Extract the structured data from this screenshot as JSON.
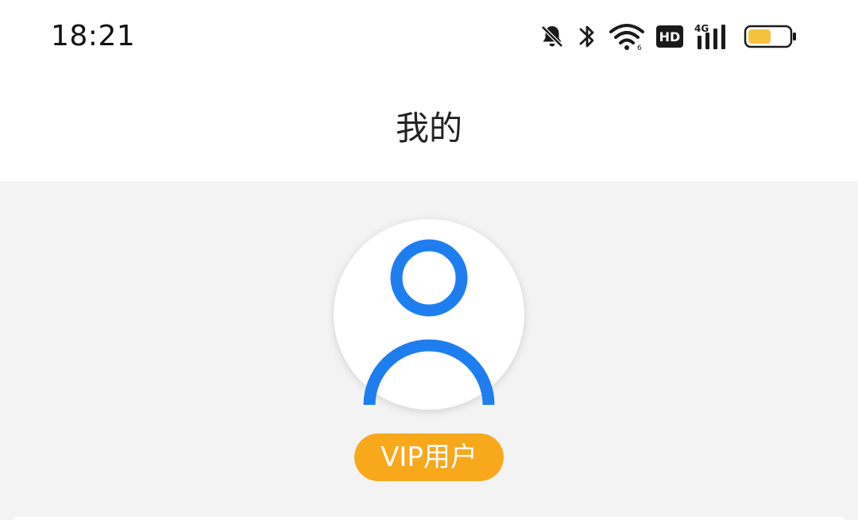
{
  "status_bar": {
    "time": "18:21",
    "icons": [
      "bell-off-icon",
      "bluetooth-icon",
      "wifi-icon",
      "hd-icon",
      "signal-4g-icon",
      "battery-icon"
    ],
    "hd_label": "HD",
    "network_label": "4G",
    "battery_level": 0.55,
    "battery_color": "#f5c23e"
  },
  "header": {
    "title": "我的"
  },
  "profile": {
    "avatar_icon": "user-icon",
    "avatar_color": "#1e7ef0",
    "badge_label": "VIP用户",
    "badge_color": "#f7a81b"
  }
}
